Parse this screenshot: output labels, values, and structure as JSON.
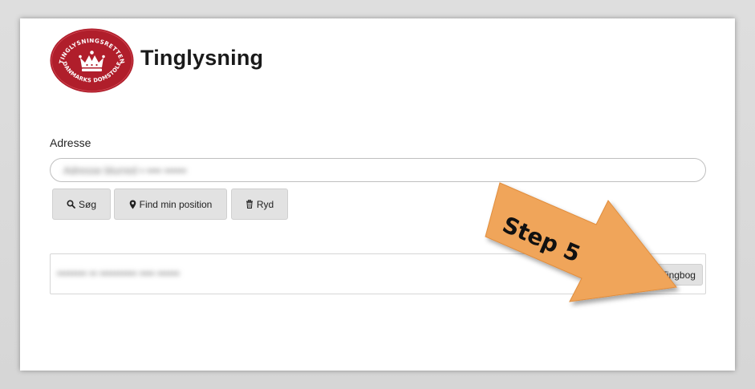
{
  "header": {
    "title": "Tinglysning",
    "seal_top_text": "TINGLYSNINGSRETTEN",
    "seal_bottom_text": "DANMARKS DOMSTOLE"
  },
  "address": {
    "label": "Adresse",
    "value": "Adresse blurred ▪ ▪▪▪▪ ▪▪▪▪▪▪"
  },
  "buttons": {
    "search": "Søg",
    "position": "Find min position",
    "clear": "Ryd"
  },
  "result": {
    "text": "▪▪▪▪▪▪▪▪ ▪▪ ▪▪▪▪▪▪▪▪▪▪ ▪▪▪▪ ▪▪▪▪▪▪",
    "tingbog_button": "Tingbog"
  },
  "annotation": {
    "label": "Step 5"
  },
  "colors": {
    "seal_red": "#b01e2b",
    "arrow_orange": "#f0a55a",
    "button_gray": "#e2e2e2"
  }
}
